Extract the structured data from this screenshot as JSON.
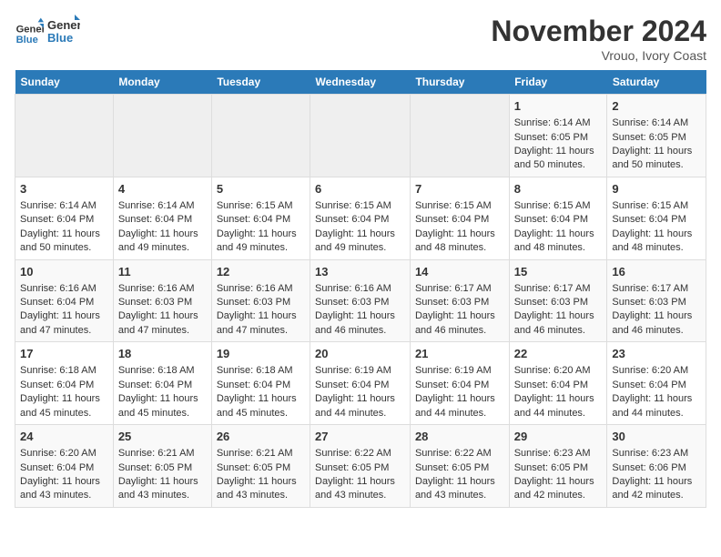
{
  "header": {
    "logo_line1": "General",
    "logo_line2": "Blue",
    "month_title": "November 2024",
    "location": "Vrouo, Ivory Coast"
  },
  "days_of_week": [
    "Sunday",
    "Monday",
    "Tuesday",
    "Wednesday",
    "Thursday",
    "Friday",
    "Saturday"
  ],
  "weeks": [
    [
      {
        "day": "",
        "empty": true
      },
      {
        "day": "",
        "empty": true
      },
      {
        "day": "",
        "empty": true
      },
      {
        "day": "",
        "empty": true
      },
      {
        "day": "",
        "empty": true
      },
      {
        "day": "1",
        "sunrise": "Sunrise: 6:14 AM",
        "sunset": "Sunset: 6:05 PM",
        "daylight": "Daylight: 11 hours and 50 minutes."
      },
      {
        "day": "2",
        "sunrise": "Sunrise: 6:14 AM",
        "sunset": "Sunset: 6:05 PM",
        "daylight": "Daylight: 11 hours and 50 minutes."
      }
    ],
    [
      {
        "day": "3",
        "sunrise": "Sunrise: 6:14 AM",
        "sunset": "Sunset: 6:04 PM",
        "daylight": "Daylight: 11 hours and 50 minutes."
      },
      {
        "day": "4",
        "sunrise": "Sunrise: 6:14 AM",
        "sunset": "Sunset: 6:04 PM",
        "daylight": "Daylight: 11 hours and 49 minutes."
      },
      {
        "day": "5",
        "sunrise": "Sunrise: 6:15 AM",
        "sunset": "Sunset: 6:04 PM",
        "daylight": "Daylight: 11 hours and 49 minutes."
      },
      {
        "day": "6",
        "sunrise": "Sunrise: 6:15 AM",
        "sunset": "Sunset: 6:04 PM",
        "daylight": "Daylight: 11 hours and 49 minutes."
      },
      {
        "day": "7",
        "sunrise": "Sunrise: 6:15 AM",
        "sunset": "Sunset: 6:04 PM",
        "daylight": "Daylight: 11 hours and 48 minutes."
      },
      {
        "day": "8",
        "sunrise": "Sunrise: 6:15 AM",
        "sunset": "Sunset: 6:04 PM",
        "daylight": "Daylight: 11 hours and 48 minutes."
      },
      {
        "day": "9",
        "sunrise": "Sunrise: 6:15 AM",
        "sunset": "Sunset: 6:04 PM",
        "daylight": "Daylight: 11 hours and 48 minutes."
      }
    ],
    [
      {
        "day": "10",
        "sunrise": "Sunrise: 6:16 AM",
        "sunset": "Sunset: 6:04 PM",
        "daylight": "Daylight: 11 hours and 47 minutes."
      },
      {
        "day": "11",
        "sunrise": "Sunrise: 6:16 AM",
        "sunset": "Sunset: 6:03 PM",
        "daylight": "Daylight: 11 hours and 47 minutes."
      },
      {
        "day": "12",
        "sunrise": "Sunrise: 6:16 AM",
        "sunset": "Sunset: 6:03 PM",
        "daylight": "Daylight: 11 hours and 47 minutes."
      },
      {
        "day": "13",
        "sunrise": "Sunrise: 6:16 AM",
        "sunset": "Sunset: 6:03 PM",
        "daylight": "Daylight: 11 hours and 46 minutes."
      },
      {
        "day": "14",
        "sunrise": "Sunrise: 6:17 AM",
        "sunset": "Sunset: 6:03 PM",
        "daylight": "Daylight: 11 hours and 46 minutes."
      },
      {
        "day": "15",
        "sunrise": "Sunrise: 6:17 AM",
        "sunset": "Sunset: 6:03 PM",
        "daylight": "Daylight: 11 hours and 46 minutes."
      },
      {
        "day": "16",
        "sunrise": "Sunrise: 6:17 AM",
        "sunset": "Sunset: 6:03 PM",
        "daylight": "Daylight: 11 hours and 46 minutes."
      }
    ],
    [
      {
        "day": "17",
        "sunrise": "Sunrise: 6:18 AM",
        "sunset": "Sunset: 6:04 PM",
        "daylight": "Daylight: 11 hours and 45 minutes."
      },
      {
        "day": "18",
        "sunrise": "Sunrise: 6:18 AM",
        "sunset": "Sunset: 6:04 PM",
        "daylight": "Daylight: 11 hours and 45 minutes."
      },
      {
        "day": "19",
        "sunrise": "Sunrise: 6:18 AM",
        "sunset": "Sunset: 6:04 PM",
        "daylight": "Daylight: 11 hours and 45 minutes."
      },
      {
        "day": "20",
        "sunrise": "Sunrise: 6:19 AM",
        "sunset": "Sunset: 6:04 PM",
        "daylight": "Daylight: 11 hours and 44 minutes."
      },
      {
        "day": "21",
        "sunrise": "Sunrise: 6:19 AM",
        "sunset": "Sunset: 6:04 PM",
        "daylight": "Daylight: 11 hours and 44 minutes."
      },
      {
        "day": "22",
        "sunrise": "Sunrise: 6:20 AM",
        "sunset": "Sunset: 6:04 PM",
        "daylight": "Daylight: 11 hours and 44 minutes."
      },
      {
        "day": "23",
        "sunrise": "Sunrise: 6:20 AM",
        "sunset": "Sunset: 6:04 PM",
        "daylight": "Daylight: 11 hours and 44 minutes."
      }
    ],
    [
      {
        "day": "24",
        "sunrise": "Sunrise: 6:20 AM",
        "sunset": "Sunset: 6:04 PM",
        "daylight": "Daylight: 11 hours and 43 minutes."
      },
      {
        "day": "25",
        "sunrise": "Sunrise: 6:21 AM",
        "sunset": "Sunset: 6:05 PM",
        "daylight": "Daylight: 11 hours and 43 minutes."
      },
      {
        "day": "26",
        "sunrise": "Sunrise: 6:21 AM",
        "sunset": "Sunset: 6:05 PM",
        "daylight": "Daylight: 11 hours and 43 minutes."
      },
      {
        "day": "27",
        "sunrise": "Sunrise: 6:22 AM",
        "sunset": "Sunset: 6:05 PM",
        "daylight": "Daylight: 11 hours and 43 minutes."
      },
      {
        "day": "28",
        "sunrise": "Sunrise: 6:22 AM",
        "sunset": "Sunset: 6:05 PM",
        "daylight": "Daylight: 11 hours and 43 minutes."
      },
      {
        "day": "29",
        "sunrise": "Sunrise: 6:23 AM",
        "sunset": "Sunset: 6:05 PM",
        "daylight": "Daylight: 11 hours and 42 minutes."
      },
      {
        "day": "30",
        "sunrise": "Sunrise: 6:23 AM",
        "sunset": "Sunset: 6:06 PM",
        "daylight": "Daylight: 11 hours and 42 minutes."
      }
    ]
  ]
}
